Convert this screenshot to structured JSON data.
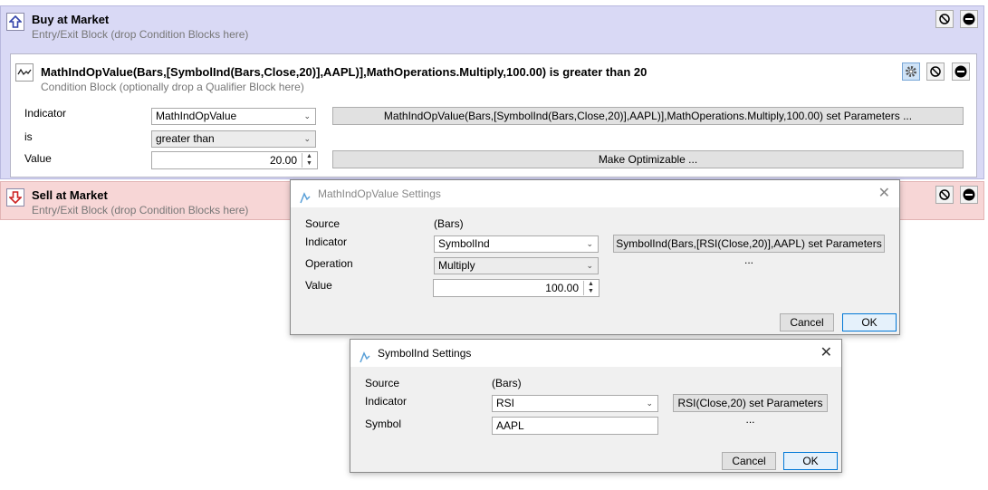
{
  "buy_block": {
    "title": "Buy at Market",
    "subtitle": "Entry/Exit Block (drop Condition Blocks here)"
  },
  "condition_block": {
    "title": "MathIndOpValue(Bars,[SymbolInd(Bars,Close,20)],AAPL)],MathOperations.Multiply,100.00) is greater than 20",
    "subtitle": "Condition Block (optionally drop a Qualifier Block here)",
    "indicator_label": "Indicator",
    "indicator_value": "MathIndOpValue",
    "indicator_params_button": "MathIndOpValue(Bars,[SymbolInd(Bars,Close,20)],AAPL)],MathOperations.Multiply,100.00) set Parameters ...",
    "is_label": "is",
    "is_value": "greater than",
    "value_label": "Value",
    "value": "20.00",
    "optimize_button": "Make Optimizable ..."
  },
  "sell_block": {
    "title": "Sell at Market",
    "subtitle": "Entry/Exit Block (drop Condition Blocks here)"
  },
  "mathind_dialog": {
    "title": "MathIndOpValue Settings",
    "source_label": "Source",
    "source_value": "(Bars)",
    "indicator_label": "Indicator",
    "indicator_value": "SymbolInd",
    "indicator_params_button": "SymbolInd(Bars,[RSI(Close,20)],AAPL) set Parameters ...",
    "operation_label": "Operation",
    "operation_value": "Multiply",
    "value_label": "Value",
    "value": "100.00",
    "cancel": "Cancel",
    "ok": "OK"
  },
  "symbolind_dialog": {
    "title": "SymbolInd Settings",
    "source_label": "Source",
    "source_value": "(Bars)",
    "indicator_label": "Indicator",
    "indicator_value": "RSI",
    "indicator_params_button": "RSI(Close,20) set Parameters ...",
    "symbol_label": "Symbol",
    "symbol_value": "AAPL",
    "cancel": "Cancel",
    "ok": "OK"
  },
  "colors": {
    "buy_bg": "#d9d9f5",
    "sell_bg": "#f7d6d6",
    "buy_arrow": "#3344aa",
    "sell_arrow": "#cc2222",
    "accent": "#0078d7"
  }
}
